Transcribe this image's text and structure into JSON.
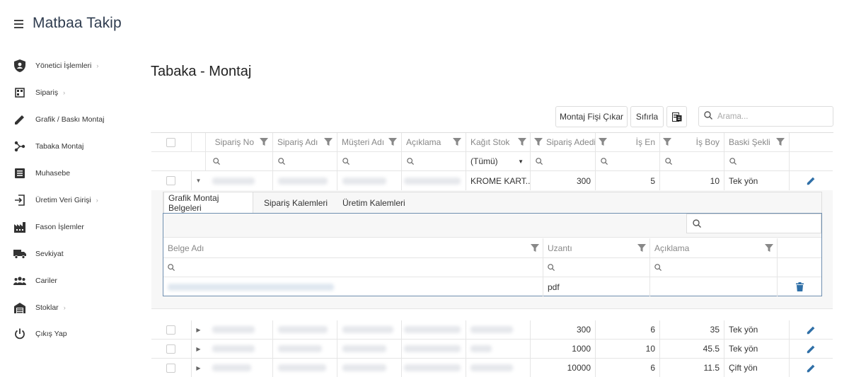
{
  "app": {
    "title": "Matbaa Takip"
  },
  "sidebar": {
    "items": [
      {
        "label": "Yönetici İşlemleri",
        "icon": "admin-shield-icon",
        "has_arrow": true
      },
      {
        "label": "Sipariş",
        "icon": "order-icon",
        "has_arrow": true
      },
      {
        "label": "Grafik / Baskı Montaj",
        "icon": "pencil-icon",
        "has_arrow": false
      },
      {
        "label": "Tabaka Montaj",
        "icon": "share-nodes-icon",
        "has_arrow": false
      },
      {
        "label": "Muhasebe",
        "icon": "ledger-icon",
        "has_arrow": false
      },
      {
        "label": "Üretim Veri Girişi",
        "icon": "login-arrow-icon",
        "has_arrow": true
      },
      {
        "label": "Fason İşlemler",
        "icon": "factory-icon",
        "has_arrow": false
      },
      {
        "label": "Sevkiyat",
        "icon": "truck-icon",
        "has_arrow": false
      },
      {
        "label": "Cariler",
        "icon": "people-icon",
        "has_arrow": false
      },
      {
        "label": "Stoklar",
        "icon": "warehouse-icon",
        "has_arrow": true
      },
      {
        "label": "Çıkış Yap",
        "icon": "power-icon",
        "has_arrow": false
      }
    ]
  },
  "page": {
    "title": "Tabaka - Montaj"
  },
  "toolbar": {
    "montaj_fisi_label": "Montaj Fişi Çıkar",
    "reset_label": "Sıfırla",
    "export_icon": "export-icon",
    "search_placeholder": "Arama..."
  },
  "grid": {
    "columns": [
      {
        "label": "Sipariş No"
      },
      {
        "label": "Sipariş Adı"
      },
      {
        "label": "Müşteri Adı"
      },
      {
        "label": "Açıklama"
      },
      {
        "label": "Kağıt Stok"
      },
      {
        "label": "Sipariş Adedi"
      },
      {
        "label": "İş En"
      },
      {
        "label": "İş Boy"
      },
      {
        "label": "Baski Şekli"
      }
    ],
    "kagit_stok_filter": "(Tümü)",
    "expanded_row": {
      "kagit_stok": "KROME KART...",
      "adet": "300",
      "en": "5",
      "boy": "10",
      "baski": "Tek yön"
    },
    "rows": [
      {
        "adet": "300",
        "en": "6",
        "boy": "35",
        "baski": "Tek yön"
      },
      {
        "adet": "1000",
        "en": "10",
        "boy": "45.5",
        "baski": "Tek yön"
      },
      {
        "adet": "10000",
        "en": "6",
        "boy": "11.5",
        "baski": "Çift yön"
      }
    ]
  },
  "detail": {
    "tabs": [
      "Grafik Montaj Belgeleri",
      "Sipariş Kalemleri",
      "Üretim Kalemleri"
    ],
    "columns": [
      {
        "label": "Belge Adı"
      },
      {
        "label": "Uzantı"
      },
      {
        "label": "Açıklama"
      }
    ],
    "rows": [
      {
        "uzanti": "pdf",
        "aciklama": ""
      }
    ]
  },
  "colors": {
    "accent": "#2f6fa7",
    "title": "#2f3c4f",
    "panel_border": "#6f8fb0"
  }
}
